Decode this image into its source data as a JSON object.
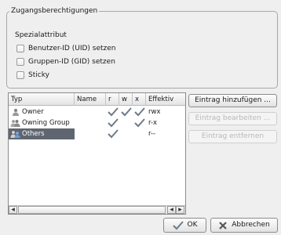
{
  "group": {
    "title": "Zugangsberechtigungen",
    "special_label": "Spezialattribut",
    "checkboxes": [
      {
        "label": "Benutzer-ID (UID) setzen",
        "checked": false
      },
      {
        "label": "Gruppen-ID (GID) setzen",
        "checked": false
      },
      {
        "label": "Sticky",
        "checked": false
      }
    ]
  },
  "table": {
    "columns": [
      "Typ",
      "Name",
      "r",
      "w",
      "x",
      "Effektiv"
    ],
    "rows": [
      {
        "type": "Owner",
        "name": "",
        "r": true,
        "w": true,
        "x": true,
        "effective": "rwx",
        "icon": "user-icon",
        "selected": false
      },
      {
        "type": "Owning Group",
        "name": "",
        "r": true,
        "w": false,
        "x": true,
        "effective": "r-x",
        "icon": "group-icon",
        "selected": false
      },
      {
        "type": "Others",
        "name": "",
        "r": true,
        "w": false,
        "x": false,
        "effective": "r--",
        "icon": "others-icon",
        "selected": true
      }
    ]
  },
  "side_buttons": {
    "add": {
      "label": "Eintrag hinzufügen ...",
      "enabled": true
    },
    "edit": {
      "label": "Eintrag bearbeiten ...",
      "enabled": false
    },
    "remove": {
      "label": "Eintrag entfernen",
      "enabled": false
    }
  },
  "dialog_buttons": {
    "ok": "OK",
    "cancel": "Abbrechen"
  },
  "colors": {
    "background": "#efefef",
    "selection": "#5f6670",
    "check": "#6d7a88"
  }
}
